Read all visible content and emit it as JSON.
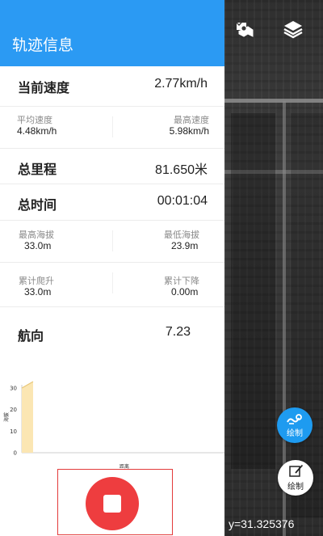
{
  "panel": {
    "title": "轨迹信息",
    "current_speed": {
      "label": "当前速度",
      "value": "2.77km/h"
    },
    "avg_speed": {
      "label": "平均速度",
      "value": "4.48km/h"
    },
    "max_speed": {
      "label": "最高速度",
      "value": "5.98km/h"
    },
    "total_distance": {
      "label": "总里程",
      "value": "81.650米"
    },
    "total_time": {
      "label": "总时间",
      "value": "00:01:04"
    },
    "max_altitude": {
      "label": "最高海拔",
      "value": "33.0m"
    },
    "min_altitude": {
      "label": "最低海拔",
      "value": "23.9m"
    },
    "total_climb": {
      "label": "累计爬升",
      "value": "33.0m"
    },
    "total_descent": {
      "label": "累计下降",
      "value": "0.00m"
    },
    "heading": {
      "label": "航向",
      "value": "7.23"
    }
  },
  "chart_data": {
    "type": "area",
    "ylabel": "海拔",
    "xlabel": "距离",
    "y_ticks": [
      "30",
      "20",
      "10",
      "0"
    ],
    "ylim": [
      0,
      30
    ],
    "x": [
      0,
      1
    ],
    "values": [
      30,
      33
    ],
    "fill_color": "#fbe6b3",
    "line_color": "#e8c77a"
  },
  "map": {
    "icons": [
      "map-marker-icon",
      "layers-icon"
    ],
    "draw_button_1": {
      "label": "绘制",
      "icon": "track-draw-icon",
      "color": "#1e9bf0"
    },
    "draw_button_2": {
      "label": "绘制",
      "icon": "edit-shape-icon"
    },
    "coordinate_text": "y=31.325376"
  },
  "controls": {
    "stop_button_icon": "stop-icon",
    "stop_color": "#ee3d3f"
  }
}
